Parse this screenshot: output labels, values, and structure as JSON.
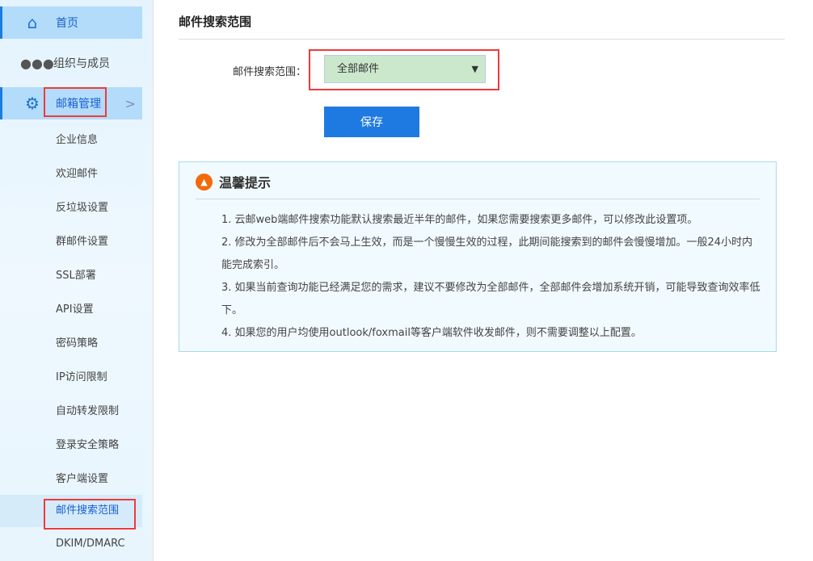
{
  "sidebar": {
    "nav": [
      {
        "label": "首页",
        "icon": "home-icon"
      },
      {
        "label": "组织与成员",
        "icon": "users-icon"
      },
      {
        "label": "邮箱管理",
        "icon": "gear-icon"
      }
    ],
    "sub": [
      "企业信息",
      "欢迎邮件",
      "反垃圾设置",
      "群邮件设置",
      "SSL部署",
      "API设置",
      "密码策略",
      "IP访问限制",
      "自动转发限制",
      "登录安全策略",
      "客户端设置",
      "邮件搜索范围",
      "DKIM/DMARC"
    ]
  },
  "main": {
    "title": "邮件搜索范围",
    "field_label": "邮件搜索范围：",
    "select_value": "全部邮件",
    "save_label": "保存",
    "tip": {
      "title": "温馨提示",
      "lines": [
        "1. 云邮web端邮件搜索功能默认搜索最近半年的邮件，如果您需要搜索更多邮件，可以修改此设置项。",
        "2. 修改为全部邮件后不会马上生效，而是一个慢慢生效的过程，此期间能搜索到的邮件会慢慢增加。一般24小时内能完成索引。",
        "3. 如果当前查询功能已经满足您的需求，建议不要修改为全部邮件，全部邮件会增加系统开销，可能导致查询效率低下。",
        "4. 如果您的用户均使用outlook/foxmail等客户端软件收发邮件，则不需要调整以上配置。"
      ]
    }
  },
  "colors": {
    "accent": "#1e7ae0",
    "highlight": "#ef3a3a",
    "select_bg": "#cbe8cd"
  }
}
